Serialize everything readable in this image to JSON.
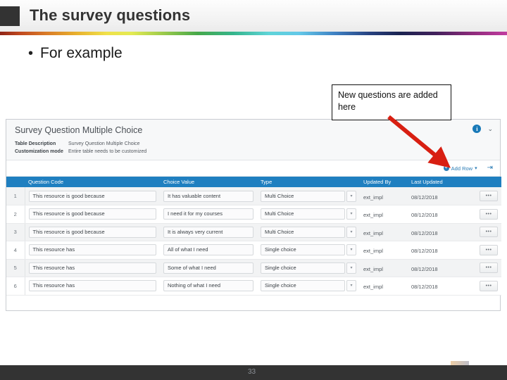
{
  "header": {
    "title": "The survey questions",
    "square_color": "#333333"
  },
  "body": {
    "bullet_marker": "•",
    "bullet_text": "For example"
  },
  "callout": {
    "text": "New questions are added here",
    "border_color": "#111111",
    "arrow_color": "#d81f12"
  },
  "screenshot": {
    "title": "Survey Question Multiple Choice",
    "meta": [
      {
        "label": "Table Description",
        "value": "Survey Question Multiple Choice"
      },
      {
        "label": "Customization mode",
        "value": "Entire table needs to be customized"
      }
    ],
    "info_icon_glyph": "i",
    "chevron_glyph": "⌄",
    "toolbar": {
      "add_row_label": "Add Row",
      "add_row_plus": "+",
      "add_row_caret": "▾",
      "export_glyph": "⇥"
    },
    "table": {
      "header_color": "#1f7fc0",
      "columns": [
        "Question Code",
        "Choice Value",
        "Type",
        "Updated By",
        "Last Updated"
      ],
      "action_glyph": "•••",
      "select_caret": "▾",
      "rows": [
        {
          "n": "1",
          "question": "This resource is good because",
          "choice": "It has valuable content",
          "type": "Multi Choice",
          "updated_by": "ext_impl",
          "last_updated": "08/12/2018"
        },
        {
          "n": "2",
          "question": "This resource is good because",
          "choice": "I need it for my courses",
          "type": "Multi Choice",
          "updated_by": "ext_impl",
          "last_updated": "08/12/2018"
        },
        {
          "n": "3",
          "question": "This resource is good because",
          "choice": "It is always very current",
          "type": "Multi Choice",
          "updated_by": "ext_impl",
          "last_updated": "08/12/2018"
        },
        {
          "n": "4",
          "question": "This resource has",
          "choice": "All of what I need",
          "type": "Single choice",
          "updated_by": "ext_impl",
          "last_updated": "08/12/2018"
        },
        {
          "n": "5",
          "question": "This resource has",
          "choice": "Some of what I need",
          "type": "Single choice",
          "updated_by": "ext_impl",
          "last_updated": "08/12/2018"
        },
        {
          "n": "6",
          "question": "This resource has",
          "choice": "Nothing of what I need",
          "type": "Single choice",
          "updated_by": "ext_impl",
          "last_updated": "08/12/2018"
        }
      ]
    }
  },
  "footer": {
    "page_number": "33"
  }
}
